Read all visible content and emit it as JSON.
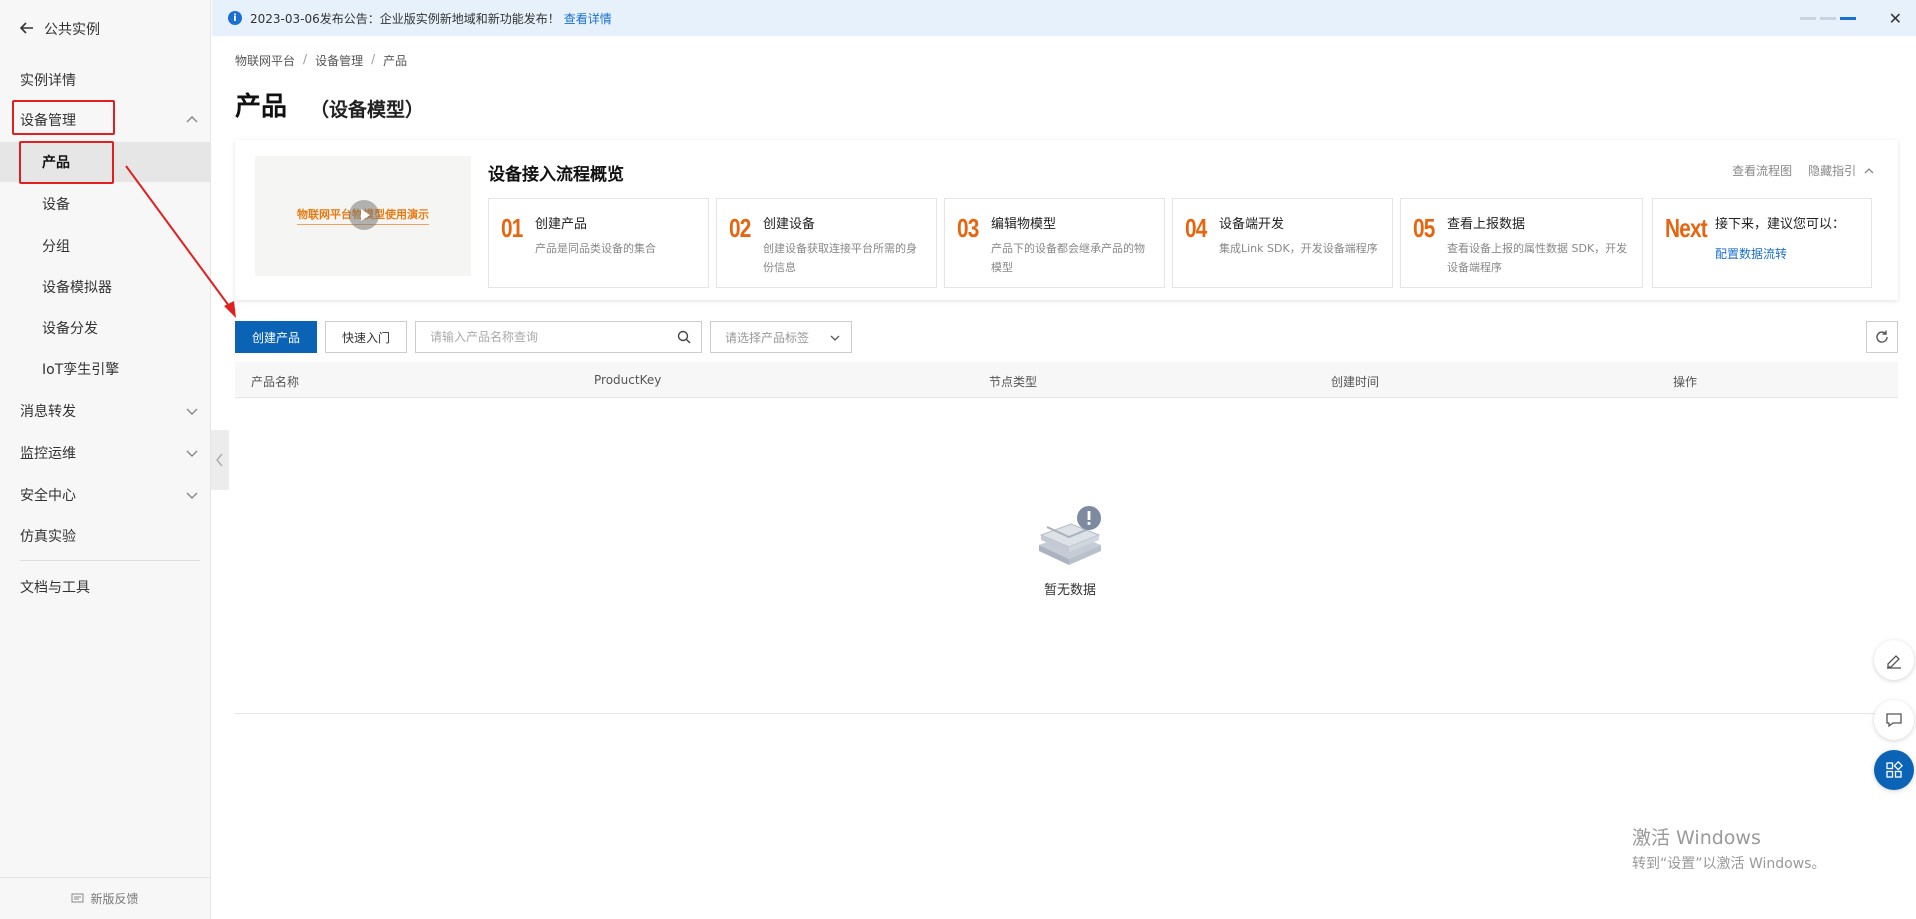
{
  "sidebar": {
    "back_label": "公共实例",
    "items": [
      {
        "label": "实例详情"
      },
      {
        "label": "设备管理"
      },
      {
        "label": "产品"
      },
      {
        "label": "设备"
      },
      {
        "label": "分组"
      },
      {
        "label": "设备模拟器"
      },
      {
        "label": "设备分发"
      },
      {
        "label": "IoT孪生引擎"
      },
      {
        "label": "消息转发"
      },
      {
        "label": "监控运维"
      },
      {
        "label": "安全中心"
      },
      {
        "label": "仿真实验"
      },
      {
        "label": "文档与工具"
      }
    ],
    "feedback_label": "新版反馈"
  },
  "announcement": {
    "text": "2023-03-06发布公告：企业版实例新地域和新功能发布！",
    "link": "查看详情"
  },
  "breadcrumb": [
    "物联网平台",
    "设备管理",
    "产品"
  ],
  "page": {
    "title": "产品",
    "subtitle": "（设备模型）"
  },
  "overview": {
    "video_title": "物联网平台物模型使用演示",
    "title": "设备接入流程概览",
    "link_flowchart": "查看流程图",
    "link_hide": "隐藏指引",
    "steps": [
      {
        "num": "01",
        "title": "创建产品",
        "desc": "产品是同品类设备的集合"
      },
      {
        "num": "02",
        "title": "创建设备",
        "desc": "创建设备获取连接平台所需的身份信息"
      },
      {
        "num": "03",
        "title": "编辑物模型",
        "desc": "产品下的设备都会继承产品的物模型"
      },
      {
        "num": "04",
        "title": "设备端开发",
        "desc": "集成Link SDK，开发设备端程序"
      },
      {
        "num": "05",
        "title": "查看上报数据",
        "desc": "查看设备上报的属性数据 SDK，开发设备端程序"
      }
    ],
    "next": {
      "num": "Next",
      "title": "接下来，建议您可以：",
      "link": "配置数据流转"
    }
  },
  "toolbar": {
    "create_label": "创建产品",
    "quickstart_label": "快速入门",
    "search_placeholder": "请输入产品名称查询",
    "tag_placeholder": "请选择产品标签"
  },
  "table": {
    "columns": [
      "产品名称",
      "ProductKey",
      "节点类型",
      "创建时间",
      "操作"
    ],
    "empty_text": "暂无数据"
  },
  "watermark": {
    "line1": "激活 Windows",
    "line2": "转到“设置”以激活 Windows。"
  },
  "colors": {
    "primary": "#0b63b6",
    "step_number": "#e8650f",
    "annotation_red": "#e02020",
    "announce_bg": "#e6f1fb"
  }
}
